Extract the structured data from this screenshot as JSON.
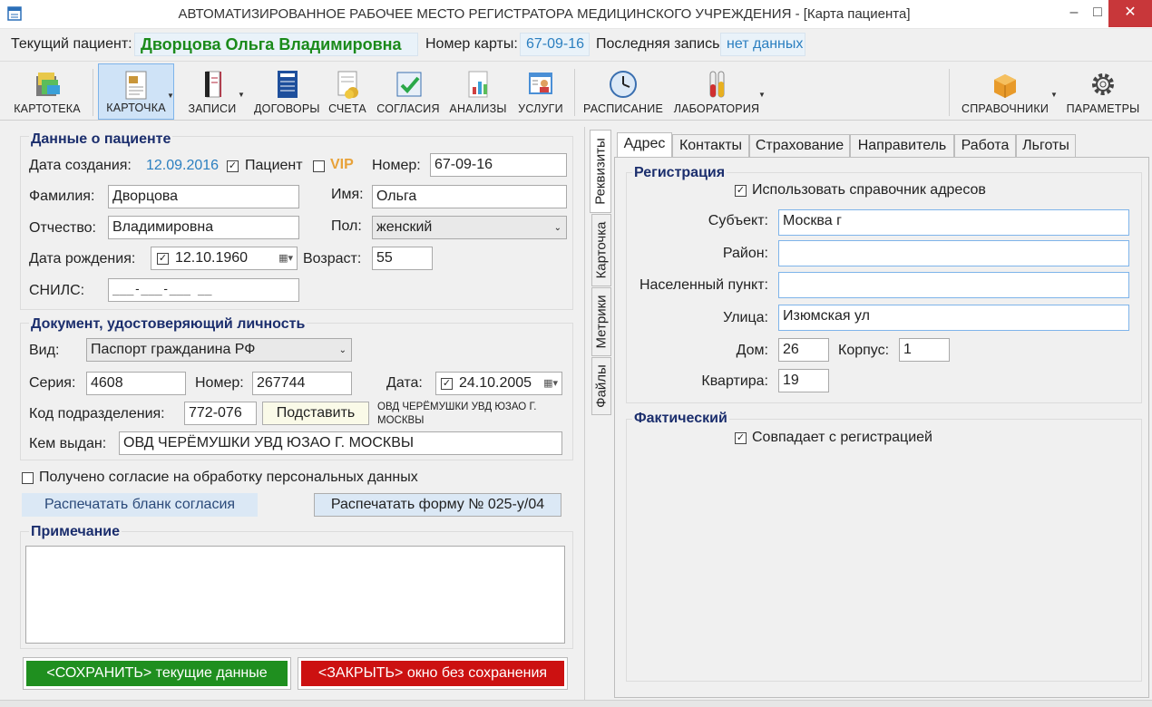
{
  "window": {
    "title": "АВТОМАТИЗИРОВАННОЕ РАБОЧЕЕ МЕСТО РЕГИСТРАТОРА МЕДИЦИНСКОГО УЧРЕЖДЕНИЯ - [Карта пациента]"
  },
  "patient_bar": {
    "current_label": "Текущий пациент:",
    "current_name": "Дворцова Ольга Владимировна",
    "card_label": "Номер карты:",
    "card_number": "67-09-16",
    "last_label": "Последняя запись:",
    "last_value": "нет данных"
  },
  "toolbar": {
    "kartoteka": "КАРТОТЕКА",
    "kartochka": "КАРТОЧКА",
    "zapisi": "ЗАПИСИ",
    "dogovory": "ДОГОВОРЫ",
    "scheta": "СЧЕТА",
    "soglasiya": "СОГЛАСИЯ",
    "analizy": "АНАЛИЗЫ",
    "uslugi": "УСЛУГИ",
    "raspisanie": "РАСПИСАНИЕ",
    "laboratoriya": "ЛАБОРАТОРИЯ",
    "spravochniki": "СПРАВОЧНИКИ",
    "parametry": "ПАРАМЕТРЫ"
  },
  "patient_data": {
    "header": "Данные о пациенте",
    "created_label": "Дата создания:",
    "created_value": "12.09.2016",
    "patient_checkbox": "Пациент",
    "vip_checkbox": "VIP",
    "number_label": "Номер:",
    "number_value": "67-09-16",
    "surname_label": "Фамилия:",
    "surname_value": "Дворцова",
    "name_label": "Имя:",
    "name_value": "Ольга",
    "patronymic_label": "Отчество:",
    "patronymic_value": "Владимировна",
    "sex_label": "Пол:",
    "sex_value": "женский",
    "birth_label": "Дата рождения:",
    "birth_value": "12.10.1960",
    "age_label": "Возраст:",
    "age_value": "55",
    "snils_label": "СНИЛС:",
    "snils_value": "___-___-___ __"
  },
  "document": {
    "header": "Документ, удостоверяющий личность",
    "type_label": "Вид:",
    "type_value": "Паспорт гражданина РФ",
    "series_label": "Серия:",
    "series_value": "4608",
    "number_label": "Номер:",
    "number_value": "267744",
    "date_label": "Дата:",
    "date_value": "24.10.2005",
    "dept_label": "Код подразделения:",
    "dept_value": "772-076",
    "insert_button": "Подставить",
    "dept_hint": "ОВД ЧЕРЁМУШКИ УВД ЮЗАО Г. МОСКВЫ",
    "issued_label": "Кем выдан:",
    "issued_value": "ОВД ЧЕРЁМУШКИ УВД ЮЗАО Г. МОСКВЫ"
  },
  "consent": {
    "checkbox_label": "Получено согласие на обработку персональных данных",
    "print_consent": "Распечатать бланк согласия",
    "print_form": "Распечатать форму № 025-у/04"
  },
  "note": {
    "header": "Примечание",
    "value": ""
  },
  "actions": {
    "save": "<СОХРАНИТЬ> текущие данные",
    "close": "<ЗАКРЫТЬ> окно без сохранения"
  },
  "vertical_tabs": [
    "Реквизиты",
    "Карточка",
    "Метрики",
    "Файлы"
  ],
  "tabs": [
    "Адрес",
    "Контакты",
    "Страхование",
    "Направитель",
    "Работа",
    "Льготы"
  ],
  "address": {
    "registration_header": "Регистрация",
    "use_directory": "Использовать справочник адресов",
    "subject_label": "Субъект:",
    "subject_value": "Москва г",
    "district_label": "Район:",
    "district_value": "",
    "locality_label": "Населенный пункт:",
    "locality_value": "",
    "street_label": "Улица:",
    "street_value": "Изюмская ул",
    "house_label": "Дом:",
    "house_value": "26",
    "building_label": "Корпус:",
    "building_value": "1",
    "flat_label": "Квартира:",
    "flat_value": "19",
    "actual_header": "Фактический",
    "same_as_registration": "Совпадает с регистрацией"
  },
  "colors": {
    "save": "#1f8f1f",
    "close": "#cc1111",
    "title_name": "#1a8a1a",
    "accent": "#1b2e6d",
    "vip": "#e8a23a",
    "date": "#2b7fc0"
  }
}
